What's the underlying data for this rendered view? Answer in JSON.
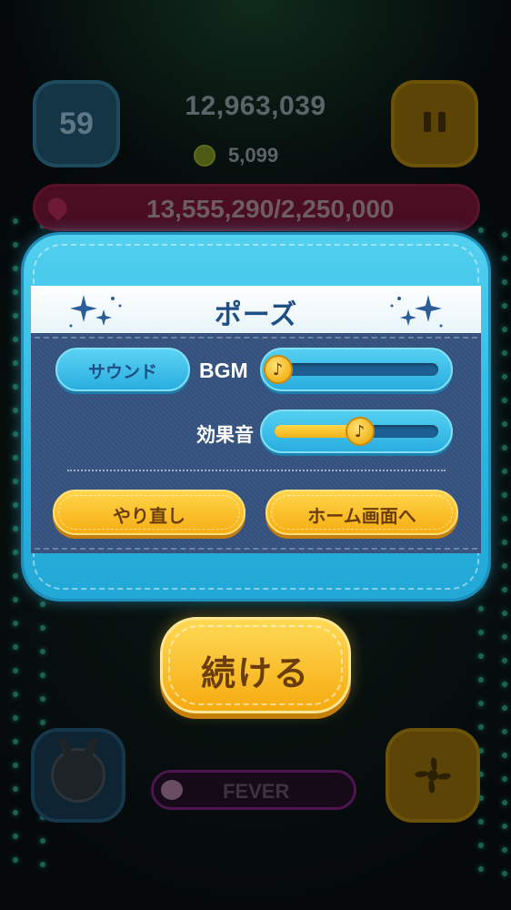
{
  "hud": {
    "time_left": "59",
    "score": "12,963,039",
    "coins": "5,099",
    "mission_progress": "13,555,290/2,250,000",
    "fever_label": "FEVER"
  },
  "pause_dialog": {
    "title": "ポーズ",
    "sound_button": "サウンド",
    "bgm_label": "BGM",
    "bgm_level": 0.02,
    "se_label": "効果音",
    "se_level": 0.52,
    "knob_glyph": "♪",
    "retry_button": "やり直し",
    "home_button": "ホーム画面へ"
  },
  "continue_button": "続ける",
  "icons": [
    "sparkle-icon",
    "pause-icon",
    "coin-icon",
    "location-pin-icon",
    "music-note-icon",
    "fan-icon",
    "character-avatar"
  ],
  "colors": {
    "dialog_frame": "#29b4e0",
    "panel": "#35527f",
    "title_text": "#1e4f86",
    "gold_button": "#f6ae12",
    "gold_button_text": "#6b3d0a"
  }
}
